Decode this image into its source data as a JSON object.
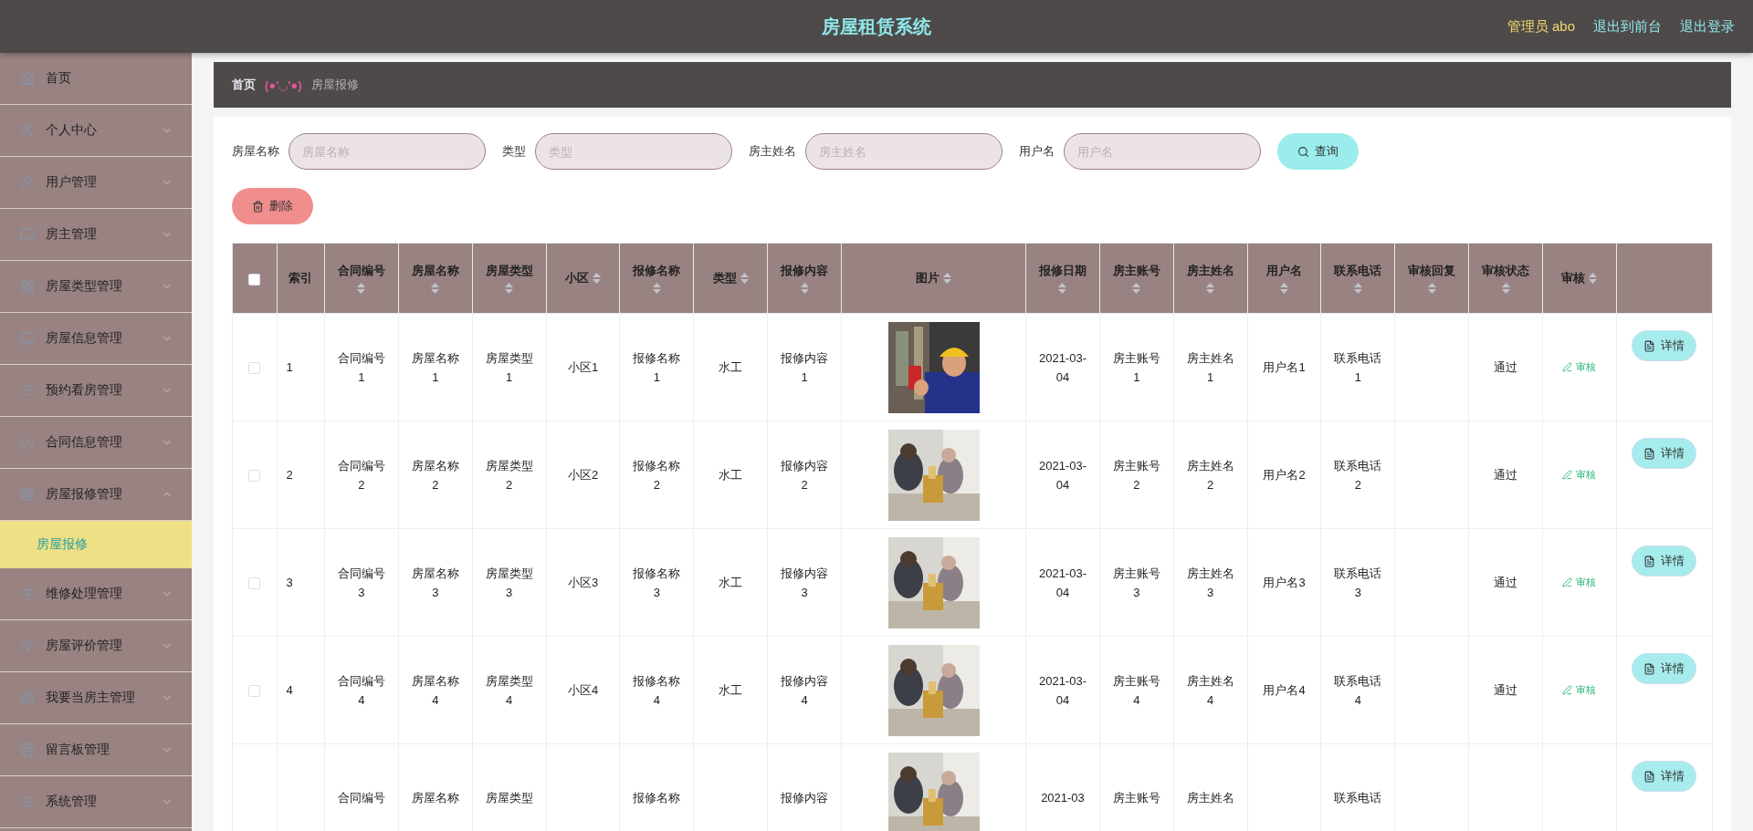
{
  "header": {
    "title": "房屋租赁系统",
    "user": "管理员 abo",
    "links": [
      "退出到前台",
      "退出登录"
    ]
  },
  "sidebar": {
    "items": [
      {
        "label": "首页",
        "kind": "link"
      },
      {
        "label": "个人中心",
        "kind": "group",
        "expanded": false
      },
      {
        "label": "用户管理",
        "kind": "group",
        "expanded": false
      },
      {
        "label": "房主管理",
        "kind": "group",
        "expanded": false
      },
      {
        "label": "房屋类型管理",
        "kind": "group",
        "expanded": false
      },
      {
        "label": "房屋信息管理",
        "kind": "group",
        "expanded": false
      },
      {
        "label": "预约看房管理",
        "kind": "group",
        "expanded": false
      },
      {
        "label": "合同信息管理",
        "kind": "group",
        "expanded": false
      },
      {
        "label": "房屋报修管理",
        "kind": "group",
        "expanded": true,
        "children": [
          {
            "label": "房屋报修",
            "selected": true
          }
        ]
      },
      {
        "label": "维修处理管理",
        "kind": "group",
        "expanded": false
      },
      {
        "label": "房屋评价管理",
        "kind": "group",
        "expanded": false
      },
      {
        "label": "我要当房主管理",
        "kind": "group",
        "expanded": false
      },
      {
        "label": "留言板管理",
        "kind": "group",
        "expanded": false
      },
      {
        "label": "系统管理",
        "kind": "group",
        "expanded": false
      }
    ]
  },
  "breadcrumb": {
    "home": "首页",
    "face": "(●'◡'●)",
    "current": "房屋报修"
  },
  "search": {
    "fields": [
      {
        "label": "房屋名称",
        "placeholder": "房屋名称"
      },
      {
        "label": "类型",
        "placeholder": "类型"
      },
      {
        "label": "房主姓名",
        "placeholder": "房主姓名"
      },
      {
        "label": "用户名",
        "placeholder": "用户名"
      }
    ],
    "button": "查询",
    "delete_button": "删除"
  },
  "table": {
    "select_all": {
      "checked": false
    },
    "columns": [
      {
        "label": "索引",
        "sortable": false,
        "kind": "index"
      },
      {
        "label": "合同编号",
        "sortable": true,
        "kind": "text"
      },
      {
        "label": "房屋名称",
        "sortable": true,
        "kind": "text"
      },
      {
        "label": "房屋类型",
        "sortable": true,
        "kind": "text"
      },
      {
        "label": "小区",
        "sortable": true,
        "kind": "text"
      },
      {
        "label": "报修名称",
        "sortable": true,
        "kind": "text"
      },
      {
        "label": "类型",
        "sortable": true,
        "kind": "text"
      },
      {
        "label": "报修内容",
        "sortable": true,
        "kind": "text"
      },
      {
        "label": "图片",
        "sortable": true,
        "kind": "picture"
      },
      {
        "label": "报修日期",
        "sortable": true,
        "kind": "text"
      },
      {
        "label": "房主账号",
        "sortable": true,
        "kind": "text"
      },
      {
        "label": "房主姓名",
        "sortable": true,
        "kind": "text"
      },
      {
        "label": "用户名",
        "sortable": true,
        "kind": "text"
      },
      {
        "label": "联系电话",
        "sortable": true,
        "kind": "text"
      },
      {
        "label": "审核回复",
        "sortable": true,
        "kind": "text"
      },
      {
        "label": "审核状态",
        "sortable": true,
        "kind": "text"
      },
      {
        "label": "审核",
        "sortable": true,
        "kind": "link"
      }
    ],
    "rows": [
      {
        "checked": false,
        "cells": [
          "1",
          "合同编号1",
          "房屋名称1",
          "房屋类型1",
          "小区1",
          "报修名称1",
          "水工",
          "报修内容1",
          {
            "kind": "picture"
          },
          "2021-03-04",
          "房主账号1",
          "房主姓名1",
          "用户名1",
          "联系电话1",
          null,
          "通过",
          "审核"
        ],
        "detail_button": "详情"
      },
      {
        "checked": false,
        "cells": [
          "2",
          "合同编号2",
          "房屋名称2",
          "房屋类型2",
          "小区2",
          "报修名称2",
          "水工",
          "报修内容2",
          {
            "kind": "picture"
          },
          "2021-03-04",
          "房主账号2",
          "房主姓名2",
          "用户名2",
          "联系电话2",
          null,
          "通过",
          "审核"
        ],
        "detail_button": "详情"
      },
      {
        "checked": false,
        "cells": [
          "3",
          "合同编号3",
          "房屋名称3",
          "房屋类型3",
          "小区3",
          "报修名称3",
          "水工",
          "报修内容3",
          {
            "kind": "picture"
          },
          "2021-03-04",
          "房主账号3",
          "房主姓名3",
          "用户名3",
          "联系电话3",
          null,
          "通过",
          "审核"
        ],
        "detail_button": "详情"
      },
      {
        "checked": false,
        "cells": [
          "4",
          "合同编号4",
          "房屋名称4",
          "房屋类型4",
          "小区4",
          "报修名称4",
          "水工",
          "报修内容4",
          {
            "kind": "picture"
          },
          "2021-03-04",
          "房主账号4",
          "房主姓名4",
          "用户名4",
          "联系电话4",
          null,
          "通过",
          "审核"
        ],
        "detail_button": "详情"
      },
      {
        "cells": [
          null,
          "合同编号",
          "房屋名称",
          "房屋类型",
          null,
          "报修名称",
          null,
          "报修内容",
          {
            "kind": "picture"
          },
          "2021-03",
          "房主账号",
          "房主姓名",
          null,
          "联系电话",
          null,
          null,
          null
        ],
        "detail_button": "详情"
      }
    ]
  }
}
